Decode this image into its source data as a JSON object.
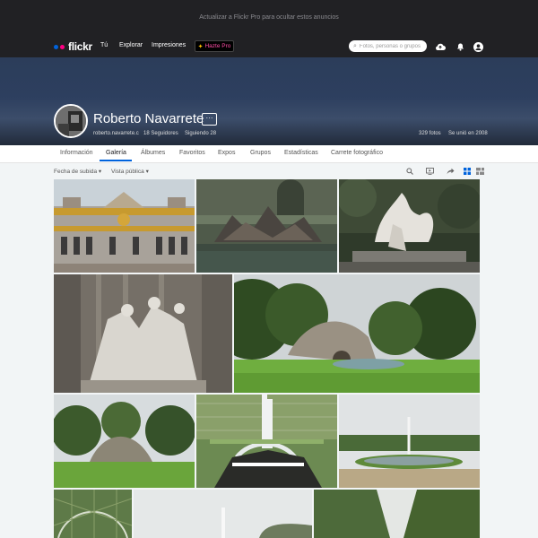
{
  "ad_bar": {
    "text": "Actualizar a Flickr Pro para ocultar estos anuncios"
  },
  "nav": {
    "logo": "flickr",
    "links": [
      "Tú",
      "Explorar",
      "Impresiones"
    ],
    "pro_label": "Hazte Pro",
    "search_placeholder": "Fotos, personas o grupos"
  },
  "profile": {
    "name": "Roberto Navarrete",
    "more_label": "···",
    "username": "roberto.navarrete.c",
    "followers": "18 Seguidores",
    "following": "Siguiendo 28",
    "photos": "329 fotos",
    "joined": "Se unió en 2008"
  },
  "tabs": [
    "Información",
    "Galería",
    "Álbumes",
    "Favoritos",
    "Expos",
    "Grupos",
    "Estadísticas",
    "Carrete fotográfico"
  ],
  "active_tab": "Galería",
  "toolbar": {
    "sort": "Fecha de subida",
    "view": "Vista pública"
  },
  "colors": {
    "flickr_blue": "#0063dc",
    "flickr_pink": "#ff0084",
    "nav_bg": "#212124"
  }
}
